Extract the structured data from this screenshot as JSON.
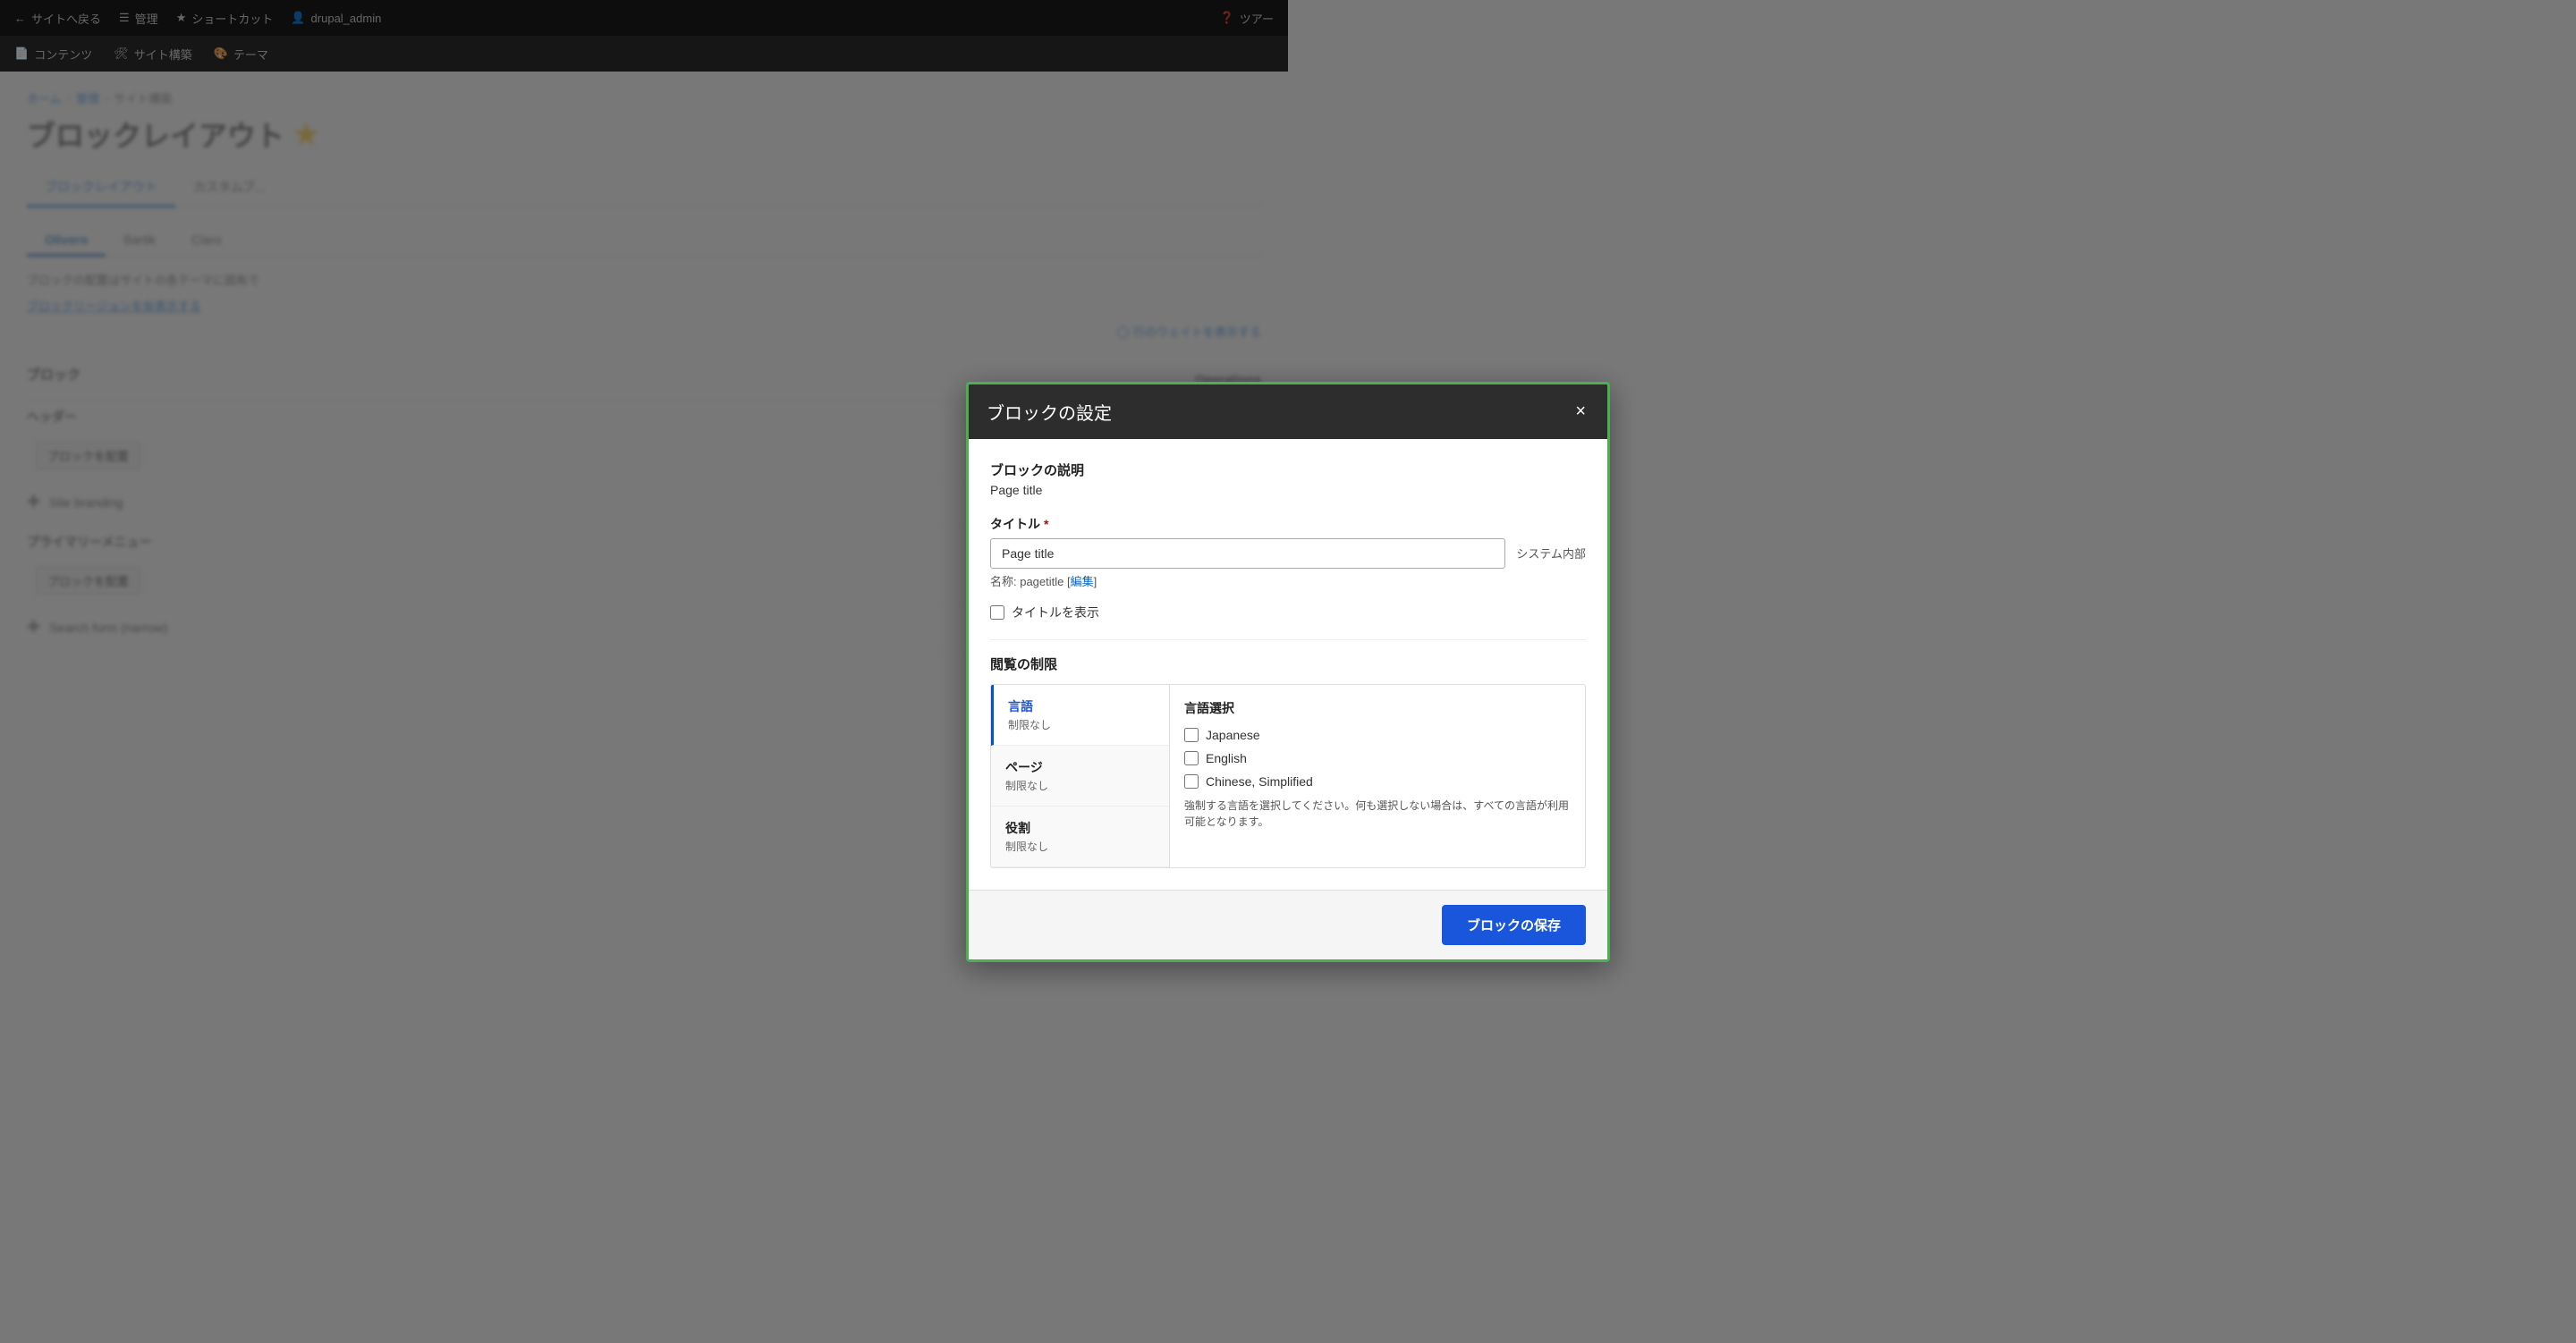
{
  "toolbar": {
    "back_label": "サイトへ戻る",
    "manage_label": "管理",
    "shortcuts_label": "ショートカット",
    "user_label": "drupal_admin",
    "tour_label": "ツアー"
  },
  "secondary_nav": {
    "items": [
      "コンテンツ",
      "サイト構築",
      "テーマ"
    ]
  },
  "breadcrumb": {
    "home": "ホーム",
    "manage": "管理",
    "site_structure": "サイト構築"
  },
  "page": {
    "title": "ブロックレイアウト",
    "tabs": [
      "ブロックレイアウト",
      "カスタムブ..."
    ],
    "theme_tabs": [
      "Olivero",
      "Bartik",
      "Claro"
    ],
    "block_info": "ブロックの配置はサイトの各テーマに固有で",
    "region_link": "ブロックリージョンを仮表示する",
    "row_weight_link": "行のウェイトを表示する"
  },
  "blocks": {
    "header_label": "ブロック",
    "header_section": "ヘッダー",
    "header_place_btn": "ブロックを配置",
    "primary_menu_section": "プライマリーメニュー",
    "primary_menu_place_btn": "ブロックを配置",
    "site_branding": "Site branding",
    "search_form": "Search form (narrow)"
  },
  "operations": {
    "header": "Operations"
  },
  "modal": {
    "title": "ブロックの設定",
    "close_btn": "×",
    "block_desc_label": "ブロックの説明",
    "block_desc_value": "Page title",
    "title_label": "タイトル",
    "title_required": true,
    "title_value": "Page title",
    "system_internal": "システム内部",
    "machine_name_prefix": "名称: pagetitle [",
    "machine_name_edit": "編集",
    "machine_name_suffix": "]",
    "show_title_label": "タイトルを表示",
    "visibility_label": "閲覧の制限",
    "visibility_tabs": [
      {
        "name": "言語",
        "desc": "制限なし",
        "active": true
      },
      {
        "name": "ページ",
        "desc": "制限なし",
        "active": false
      },
      {
        "name": "役割",
        "desc": "制限なし",
        "active": false
      }
    ],
    "language_selection_title": "言語選択",
    "languages": [
      {
        "label": "Japanese",
        "checked": false
      },
      {
        "label": "English",
        "checked": false
      },
      {
        "label": "Chinese, Simplified",
        "checked": false
      }
    ],
    "language_hint": "強制する言語を選択してください。何も選択しない場合は、すべての言語が利用可能となります。",
    "save_btn": "ブロックの保存"
  }
}
